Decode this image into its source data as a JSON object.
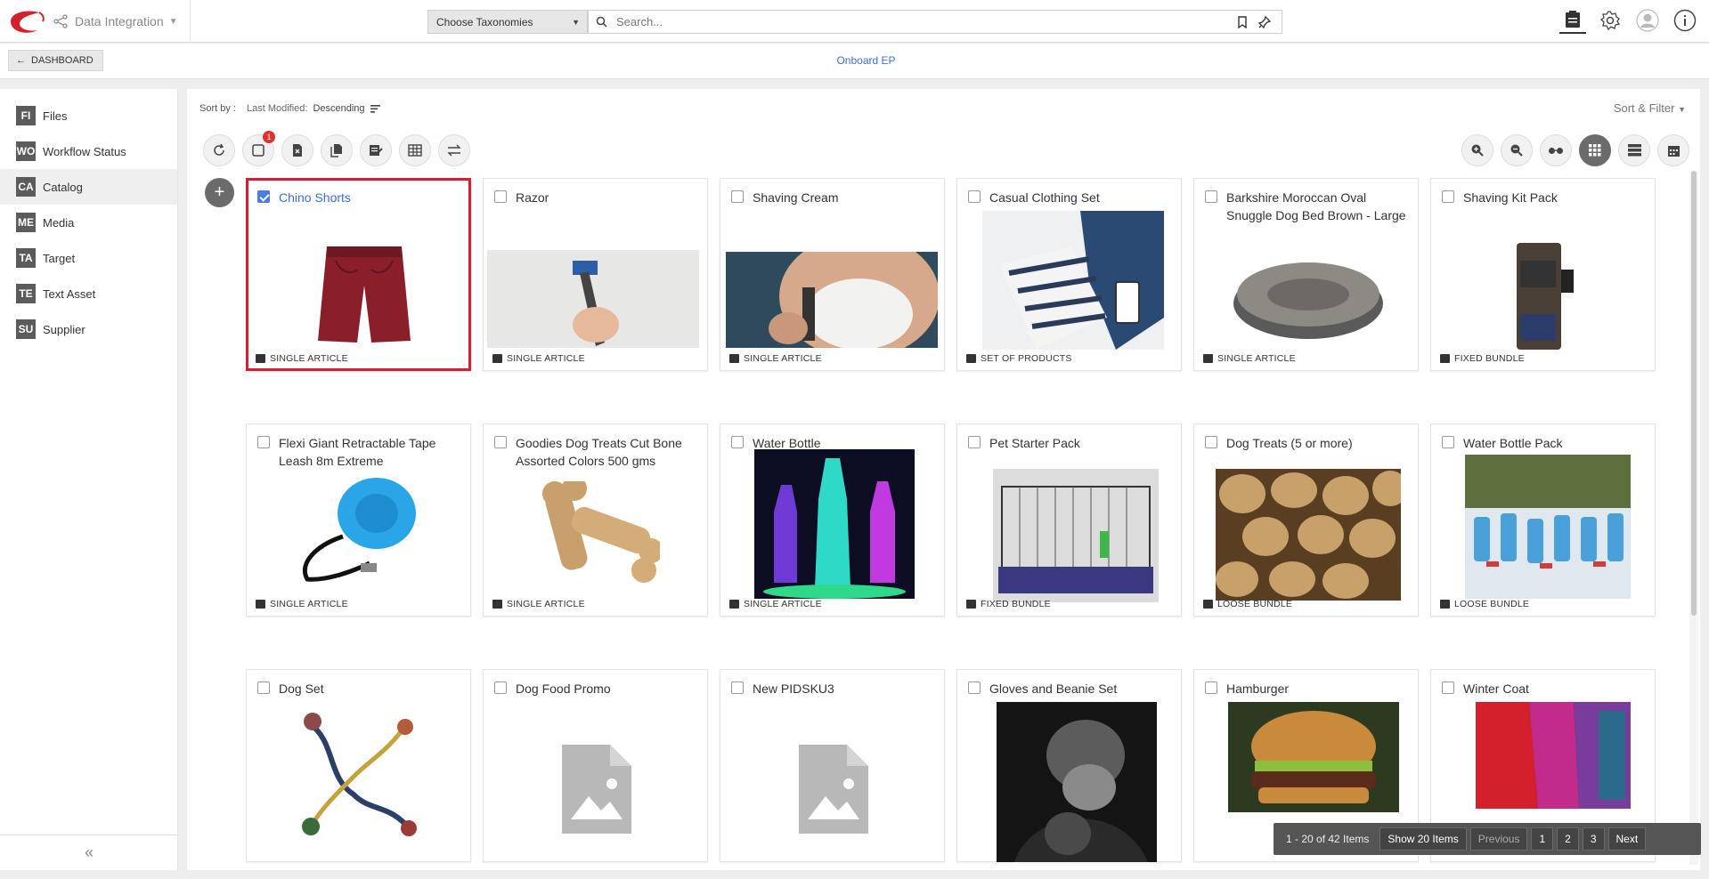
{
  "header": {
    "app_name": "Data Integration",
    "taxonomy_select": "Choose Taxonomies",
    "search_placeholder": "Search..."
  },
  "subheader": {
    "dashboard_label": "DASHBOARD",
    "breadcrumb": "Onboard EP"
  },
  "sidebar": {
    "items": [
      {
        "abbr": "FI",
        "label": "Files"
      },
      {
        "abbr": "WO",
        "label": "Workflow Status"
      },
      {
        "abbr": "CA",
        "label": "Catalog"
      },
      {
        "abbr": "ME",
        "label": "Media"
      },
      {
        "abbr": "TA",
        "label": "Target"
      },
      {
        "abbr": "TE",
        "label": "Text Asset"
      },
      {
        "abbr": "SU",
        "label": "Supplier"
      }
    ],
    "collapse_label": "«"
  },
  "sort": {
    "label": "Sort by :",
    "field": "Last Modified:",
    "order": "Descending",
    "filter_label": "Sort & Filter"
  },
  "toolbar": {
    "selection_count": "1",
    "add_label": "+"
  },
  "cards": [
    {
      "title": "Chino Shorts",
      "type": "SINGLE ARTICLE",
      "selected": true
    },
    {
      "title": "Razor",
      "type": "SINGLE ARTICLE"
    },
    {
      "title": "Shaving Cream",
      "type": "SINGLE ARTICLE"
    },
    {
      "title": "Casual Clothing Set",
      "type": "SET OF PRODUCTS"
    },
    {
      "title": "Barkshire Moroccan Oval Snuggle Dog Bed Brown - Large ...",
      "type": "SINGLE ARTICLE"
    },
    {
      "title": "Shaving Kit Pack",
      "type": "FIXED BUNDLE"
    },
    {
      "title": "Flexi Giant Retractable Tape Leash 8m Extreme",
      "type": "SINGLE ARTICLE"
    },
    {
      "title": "Goodies Dog Treats Cut Bone Assorted Colors 500 gms",
      "type": "SINGLE ARTICLE"
    },
    {
      "title": "Water Bottle",
      "type": "SINGLE ARTICLE"
    },
    {
      "title": "Pet Starter Pack",
      "type": "FIXED BUNDLE"
    },
    {
      "title": "Dog Treats (5 or more)",
      "type": "LOOSE BUNDLE"
    },
    {
      "title": "Water Bottle Pack",
      "type": "LOOSE BUNDLE"
    },
    {
      "title": "Dog Set",
      "type": ""
    },
    {
      "title": "Dog Food Promo",
      "type": ""
    },
    {
      "title": "New PIDSKU3",
      "type": ""
    },
    {
      "title": "Gloves and Beanie Set",
      "type": ""
    },
    {
      "title": "Hamburger",
      "type": ""
    },
    {
      "title": "Winter Coat",
      "type": ""
    }
  ],
  "pagination": {
    "range": "1 - 20 of 42 Items",
    "show": "Show 20 Items",
    "previous": "Previous",
    "pages": [
      "1",
      "2",
      "3"
    ],
    "next": "Next"
  },
  "colors": {
    "accent": "#3a6fd8",
    "selected_border": "#d32030",
    "badge": "#e0312c"
  }
}
